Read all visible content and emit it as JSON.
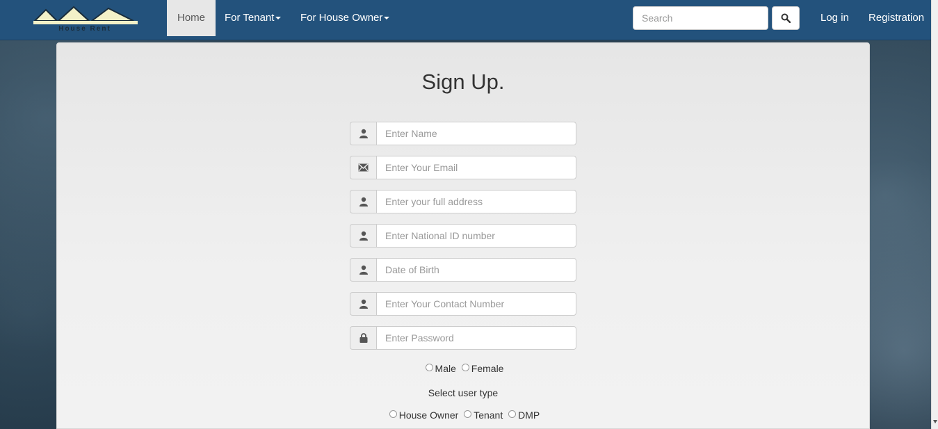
{
  "navbar": {
    "logo_text": "House Rent",
    "items": [
      {
        "label": "Home"
      },
      {
        "label": "For Tenant"
      },
      {
        "label": "For House Owner"
      }
    ],
    "search_placeholder": "Search",
    "login_label": "Log in",
    "registration_label": "Registration",
    "colors": {
      "bar": "#23527c",
      "active_bg": "#e7e7e7"
    }
  },
  "form": {
    "title": "Sign Up.",
    "fields": [
      {
        "icon": "user-icon",
        "placeholder": "Enter Name"
      },
      {
        "icon": "envelope-icon",
        "placeholder": "Enter Your Email"
      },
      {
        "icon": "user-icon",
        "placeholder": "Enter your full address"
      },
      {
        "icon": "user-icon",
        "placeholder": "Enter National ID number"
      },
      {
        "icon": "user-icon",
        "placeholder": "Date of Birth"
      },
      {
        "icon": "user-icon",
        "placeholder": "Enter Your Contact Number"
      },
      {
        "icon": "lock-icon",
        "placeholder": "Enter Password"
      }
    ],
    "gender_options": [
      "Male",
      "Female"
    ],
    "user_type_label": "Select user type",
    "user_types": [
      "House Owner",
      "Tenant",
      "DMP"
    ]
  }
}
